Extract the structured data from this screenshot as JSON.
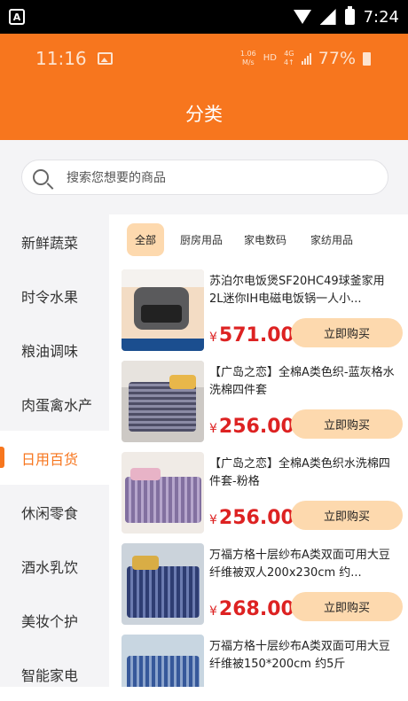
{
  "system_status": {
    "badge": "A",
    "time": "7:24"
  },
  "inner_status": {
    "time": "11:16",
    "speed_top": "1.06",
    "speed_bottom": "M/s",
    "hd": "HD",
    "network_top": "4G",
    "network_bottom": "4↑",
    "battery": "77%"
  },
  "header": {
    "title": "分类",
    "bg_color": "#f7761e"
  },
  "search": {
    "placeholder": "搜索您想要的商品"
  },
  "sidebar": {
    "items": [
      {
        "label": "新鲜蔬菜",
        "active": false
      },
      {
        "label": "时令水果",
        "active": false
      },
      {
        "label": "粮油调味",
        "active": false
      },
      {
        "label": "肉蛋禽水产",
        "active": false
      },
      {
        "label": "日用百货",
        "active": true
      },
      {
        "label": "休闲零食",
        "active": false
      },
      {
        "label": "酒水乳饮",
        "active": false
      },
      {
        "label": "美妆个护",
        "active": false
      },
      {
        "label": "智能家电",
        "active": false
      }
    ]
  },
  "tabs": [
    {
      "label": "全部",
      "active": true
    },
    {
      "label": "厨房用品",
      "active": false
    },
    {
      "label": "家电数码",
      "active": false
    },
    {
      "label": "家纺用品",
      "active": false
    }
  ],
  "currency_symbol": "¥",
  "buy_label": "立即购买",
  "products": [
    {
      "name": "苏泊尔电饭煲SF20HC49球釜家用2L迷你IH电磁电饭锅一人小...",
      "price": "571.00"
    },
    {
      "name": "【广岛之恋】全棉A类色织-蓝灰格水洗棉四件套",
      "price": "256.00"
    },
    {
      "name": "【广岛之恋】全棉A类色织水洗棉四件套-粉格",
      "price": "256.00"
    },
    {
      "name": "万福方格十层纱布A类双面可用大豆纤维被双人200x230cm 约...",
      "price": "268.00"
    },
    {
      "name": "万福方格十层纱布A类双面可用大豆纤维被150*200cm 约5斤",
      "price": ""
    }
  ],
  "colors": {
    "accent": "#f7761e",
    "price": "#dd2222",
    "buy_button": "#fdd9ae"
  }
}
